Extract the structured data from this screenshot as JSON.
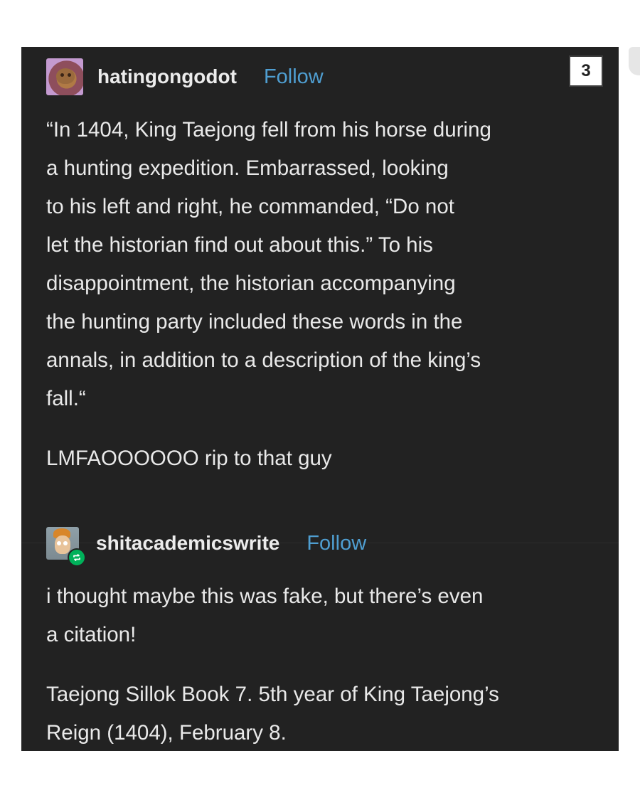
{
  "thread": {
    "reblog_count": "3",
    "posts": [
      {
        "username": "hatingongodot",
        "follow_label": "Follow",
        "quote": "“In 1404, King Taejong fell from his horse during\na hunting expedition. Embarrassed, looking\nto his left and right, he commanded, “Do not\nlet the historian find out about this.” To his\ndisappointment, the historian accompanying\nthe hunting party included these words in the\nannals, in addition to a description of the king’s\nfall.“",
        "comment": "LMFAOOOOOO rip to that guy"
      },
      {
        "username": "shitacademicswrite",
        "follow_label": "Follow",
        "reply": "i thought maybe this was fake, but there’s even\na citation!",
        "citation": "Taejong Sillok Book 7. 5th year of King Taejong’s\nReign (1404), February 8."
      }
    ]
  },
  "colors": {
    "post_background": "#222222",
    "text": "#e9e9e9",
    "follow_link": "#4f9ed1",
    "reblog_badge": "#00b15a"
  },
  "icons": {
    "avatar_1": "avatar-image",
    "avatar_2": "avatar-image",
    "reblog": "reblog-icon"
  }
}
